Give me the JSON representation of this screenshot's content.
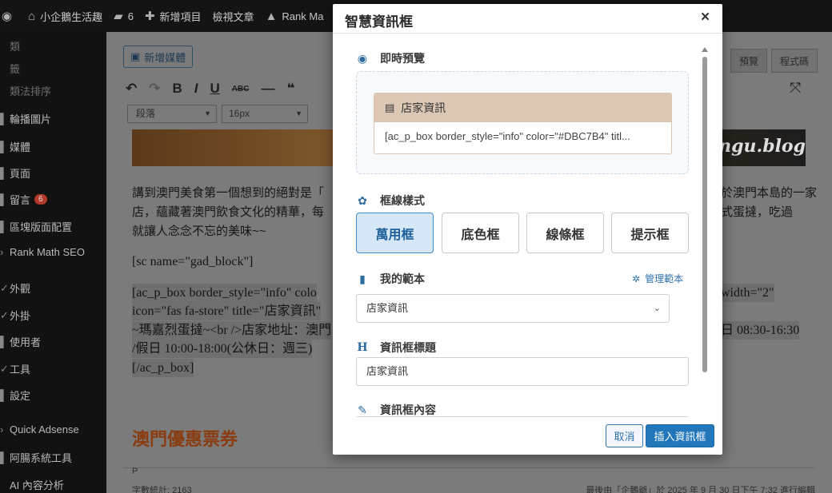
{
  "adminbar": {
    "items": [
      {
        "icon": "wordpress-icon",
        "label": ""
      },
      {
        "icon": "home-icon",
        "label": "小企鵝生活趣"
      },
      {
        "icon": "comment-icon",
        "label": "6"
      },
      {
        "icon": "plus-icon",
        "label": "新增項目"
      },
      {
        "icon": "",
        "label": "檢視文章"
      },
      {
        "icon": "rankmath-icon",
        "label": "Rank Ma"
      }
    ]
  },
  "sidebar": {
    "items": [
      {
        "label": "類",
        "bullet": ""
      },
      {
        "label": "籤",
        "bullet": ""
      },
      {
        "label": "類法排序",
        "bullet": ""
      },
      {
        "label": "輪播圖片",
        "bullet": "▌"
      },
      {
        "label": "媒體",
        "bullet": "▌"
      },
      {
        "label": "頁面",
        "bullet": "▌"
      },
      {
        "label": "留言",
        "bullet": "▌",
        "badge": "6"
      },
      {
        "label": "區塊版面配置",
        "bullet": "▌"
      },
      {
        "label": "Rank Math SEO",
        "bullet": "›"
      },
      {
        "label": "外觀",
        "bullet": "✓"
      },
      {
        "label": "外掛",
        "bullet": "✓"
      },
      {
        "label": "使用者",
        "bullet": "▌"
      },
      {
        "label": "工具",
        "bullet": "✓"
      },
      {
        "label": "設定",
        "bullet": "▌"
      },
      {
        "label": "Quick Adsense",
        "bullet": "›"
      },
      {
        "label": "阿腸系統工具",
        "bullet": "▌"
      },
      {
        "label": "AI 內容分析",
        "bullet": ""
      }
    ]
  },
  "editor": {
    "media_button": "新增媒體",
    "tab_preview": "預覽",
    "tab_code": "程式碼",
    "format_select": "段落",
    "size_select": "16px",
    "banner_text": "ngu.blog",
    "paragraph_lines": [
      "講到澳門美食第一個想到的絕對是「",
      "店，蘊藏著澳門飲食文化的精華，每",
      "就讓人念念不忘的美味~~"
    ],
    "paragraph_right_lines": [
      "於澳門本島的一家",
      "式蛋撻，吃過"
    ],
    "shortcode_line": "[sc name=\"gad_block\"]",
    "code_lines": [
      "[ac_p_box border_style=\"info\" colo",
      "icon=\"fas fa-store\" title=\"店家資訊\"",
      "~瑪嘉烈蛋撻~<br />店家地址：澳門",
      "/假日 10:00-18:00(公休日：週三)",
      "[/ac_p_box]"
    ],
    "code_right_lines": [
      "width=\"2\"",
      "日 08:30-16:30"
    ],
    "heading": "澳門優惠票券",
    "path_label": "P",
    "word_count": "字數統計: 2163",
    "last_edit": "最後由「企鵝爺」於 2025 年 9 月 30 日下午 7:32 進行編輯"
  },
  "modal": {
    "title": "智慧資訊框",
    "close_label": "×",
    "preview_section": {
      "label": "即時預覽",
      "box_title": "店家資訊",
      "box_content": "[ac_p_box border_style=\"info\" color=\"#DBC7B4\" titl..."
    },
    "style_section": {
      "label": "框線樣式",
      "options": [
        {
          "label": "萬用框",
          "active": true
        },
        {
          "label": "底色框",
          "active": false
        },
        {
          "label": "線條框",
          "active": false
        },
        {
          "label": "提示框",
          "active": false
        }
      ]
    },
    "template_section": {
      "label": "我的範本",
      "manage_label": "管理範本",
      "selected": "店家資訊"
    },
    "title_section": {
      "label": "資訊框標題",
      "value": "店家資訊"
    },
    "content_section": {
      "label": "資訊框內容"
    },
    "cancel_label": "取消",
    "insert_label": "插入資訊框"
  },
  "colors": {
    "accent": "#2277bb",
    "box_color": "#DBC7B4",
    "active_style": "#d6e8f8"
  }
}
